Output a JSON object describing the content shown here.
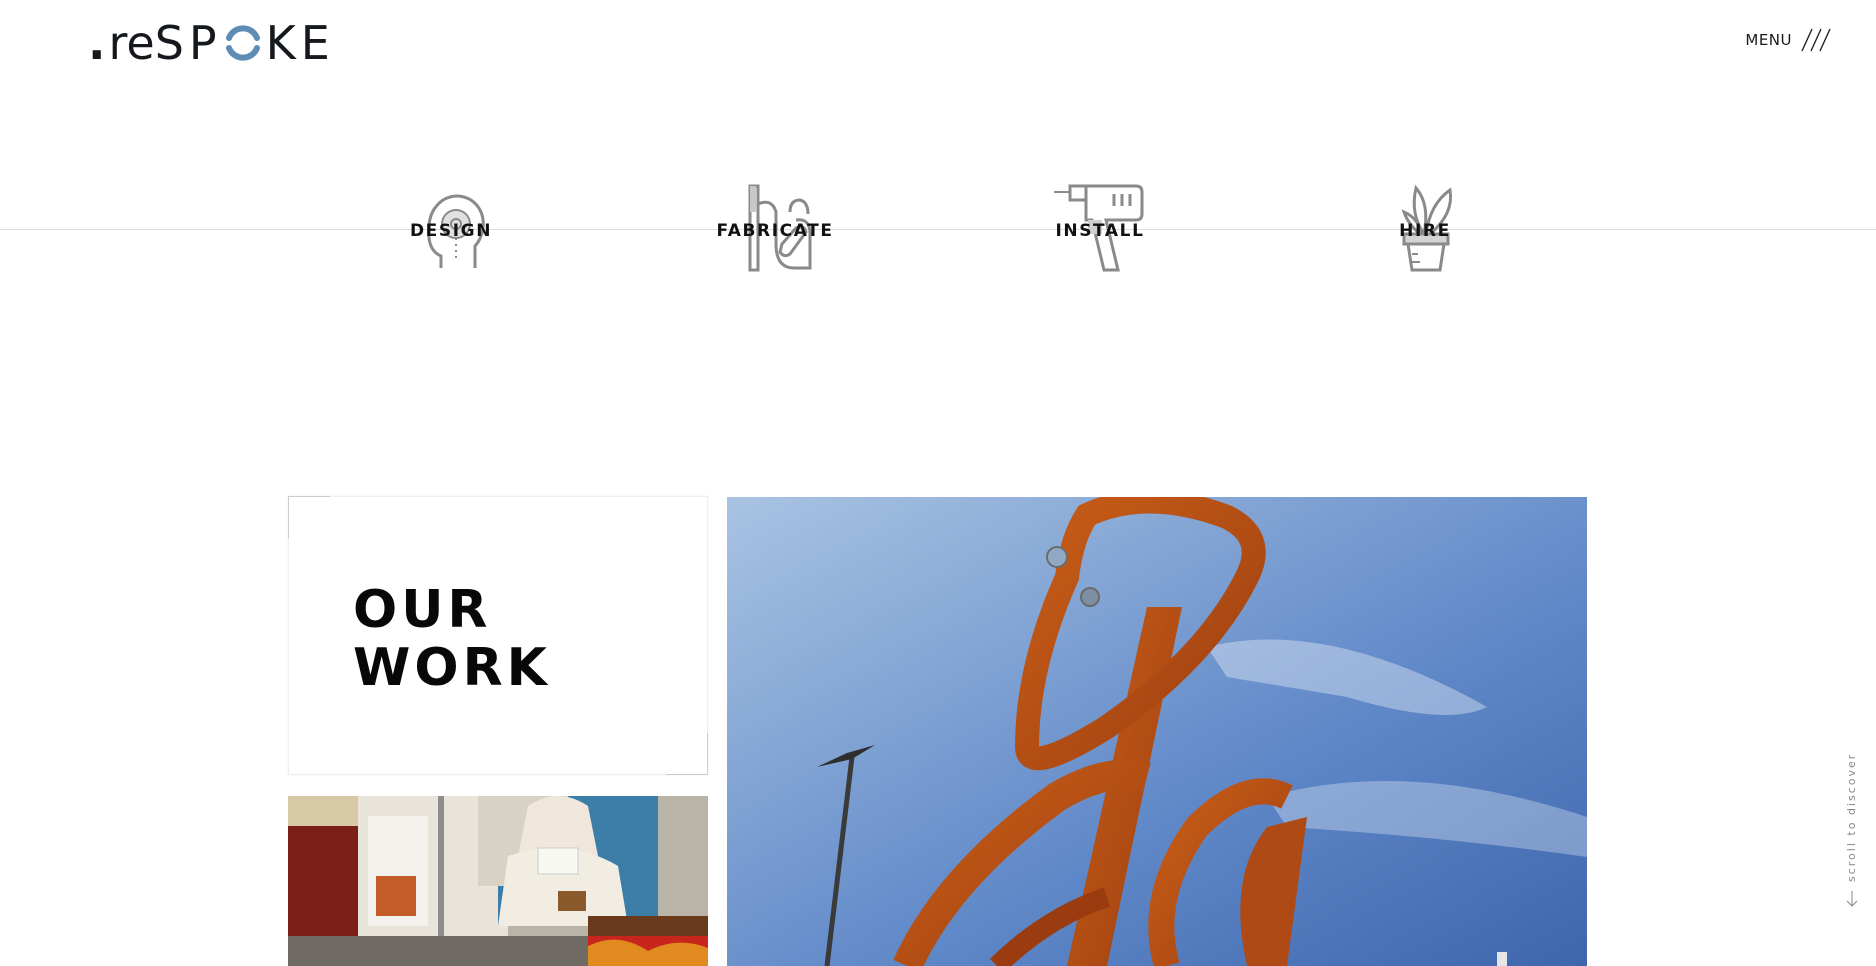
{
  "header": {
    "logo": {
      "dot": ".",
      "prefix": "re",
      "part1": "SP",
      "part2": "KE"
    },
    "menu_label": "MENU",
    "menu_icon": "triple-slash-icon"
  },
  "services": [
    {
      "label": "DESIGN",
      "icon": "head-gear-icon"
    },
    {
      "label": "FABRICATE",
      "icon": "wrench-tools-icon"
    },
    {
      "label": "INSTALL",
      "icon": "drill-icon"
    },
    {
      "label": "HIRE",
      "icon": "potted-plant-icon"
    }
  ],
  "work": {
    "title_line1": "OUR",
    "title_line2": "WORK"
  },
  "scroll_hint": "scroll to discover",
  "colors": {
    "accent": "#5d8cb5",
    "text": "#111111",
    "divider": "#dcdcdc",
    "icon_stroke": "#8a8a8a"
  }
}
